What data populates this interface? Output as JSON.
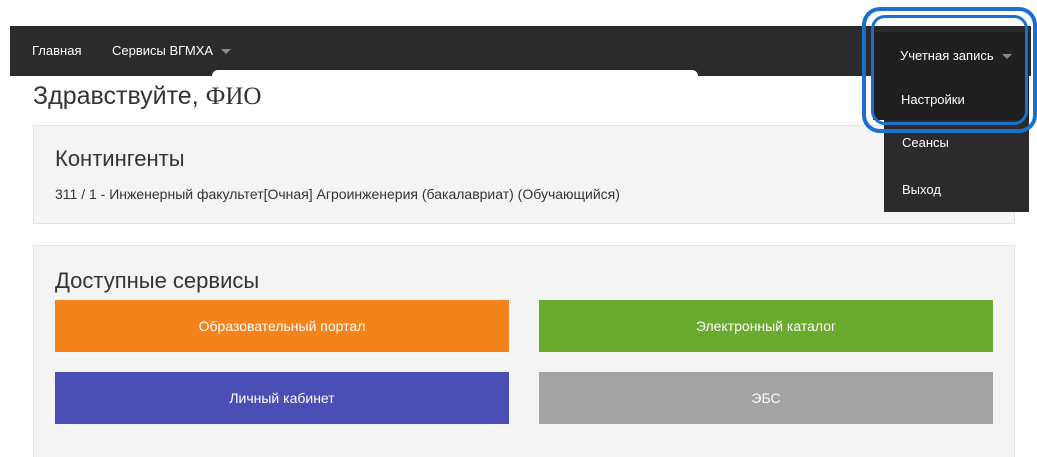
{
  "navbar": {
    "home_label": "Главная",
    "services_label": "Сервисы ВГМХА",
    "account_label": "Учетная запись"
  },
  "account_menu": {
    "items": [
      "Настройки",
      "Сеансы",
      "Выход"
    ]
  },
  "greeting": {
    "prefix": "Здравствуйте, ",
    "name": "ФИО"
  },
  "contingents": {
    "title": "Контингенты",
    "line": "311 / 1 - Инженерный факультет[Очная] Агроинженерия (бакалавриат) (Обучающийся)"
  },
  "services": {
    "title": "Доступные сервисы",
    "buttons": {
      "portal": "Образовательный портал",
      "catalog": "Электронный каталог",
      "cabinet": "Личный кабинет",
      "ebs": "ЭБС"
    }
  },
  "colors": {
    "navbar": "#2b2b2b",
    "portal": "#f5831b",
    "catalog": "#6aaa2e",
    "cabinet": "#4a4fb5",
    "ebs": "#a3a3a3",
    "highlight": "#1a6fd1"
  }
}
